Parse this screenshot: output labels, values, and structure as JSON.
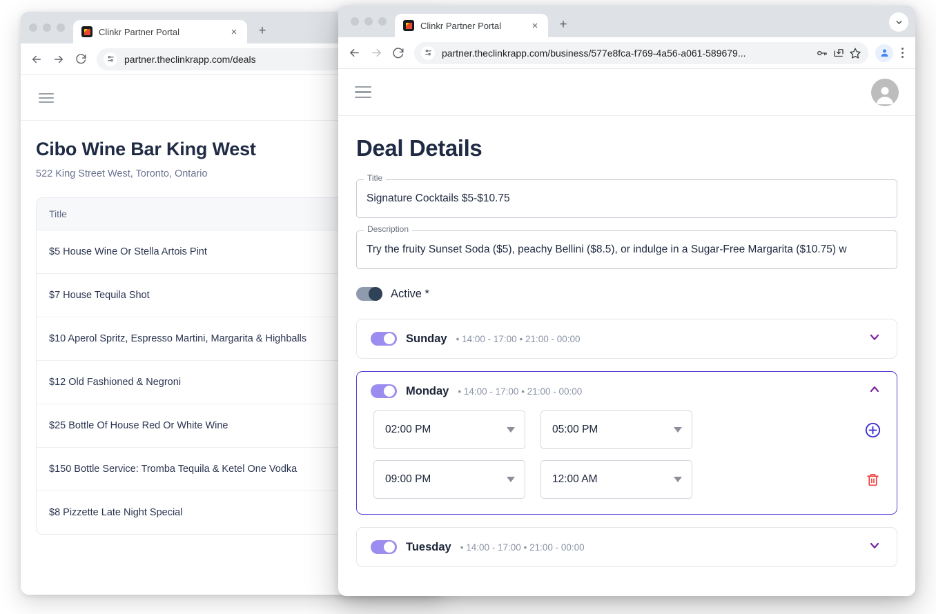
{
  "background_window": {
    "browser": {
      "tab_title": "Clinkr Partner Portal",
      "url": "partner.theclinkrapp.com/deals",
      "new_tab_label": "+",
      "close_label": "×",
      "back_icon": "back-arrow-icon",
      "forward_icon": "forward-arrow-icon",
      "reload_icon": "reload-icon"
    },
    "page": {
      "menu_icon": "hamburger-menu-icon",
      "business_name": "Cibo Wine Bar King West",
      "business_address": "522 King Street West, Toronto, Ontario",
      "table": {
        "column_header": "Title",
        "rows": [
          "$5 House Wine Or Stella Artois Pint",
          "$7 House Tequila Shot",
          "$10 Aperol Spritz, Espresso Martini, Margarita & Highballs",
          "$12 Old Fashioned & Negroni",
          "$25 Bottle Of House Red Or White Wine",
          "$150 Bottle Service: Tromba Tequila & Ketel One Vodka",
          "$8 Pizzette Late Night Special"
        ]
      }
    }
  },
  "foreground_window": {
    "browser": {
      "tab_title": "Clinkr Partner Portal",
      "url": "partner.theclinkrapp.com/business/577e8fca-f769-4a56-a061-589679...",
      "new_tab_label": "+",
      "close_label": "×",
      "toolbar_icons": [
        "back-arrow-icon",
        "forward-arrow-icon",
        "reload-icon",
        "site-settings-icon",
        "password-key-icon",
        "install-app-icon",
        "bookmark-star-icon",
        "profile-avatar-icon",
        "three-dot-menu-icon"
      ],
      "window_chevron_icon": "chevron-down-icon"
    },
    "page": {
      "menu_icon": "hamburger-menu-icon",
      "account_icon": "account-avatar-icon",
      "heading": "Deal Details",
      "fields": [
        {
          "label": "Title",
          "value": "Signature Cocktails $5-$10.75"
        },
        {
          "label": "Description",
          "value": "Try the fruity Sunset Soda ($5), peachy Bellini ($8.5), or indulge in a Sugar-Free Margarita ($10.75) w"
        }
      ],
      "active_toggle": {
        "label": "Active *",
        "state": "on"
      },
      "days": [
        {
          "name": "Sunday",
          "toggle": "on",
          "summary_separator": "•",
          "ranges": [
            "14:00 - 17:00",
            "21:00 - 00:00"
          ],
          "expanded": false,
          "chevron_icon": "chevron-down-icon"
        },
        {
          "name": "Monday",
          "toggle": "on",
          "summary_separator": "•",
          "ranges": [
            "14:00 - 17:00",
            "21:00 - 00:00"
          ],
          "expanded": true,
          "chevron_icon": "chevron-up-icon",
          "slots": [
            {
              "start": "02:00 PM",
              "end": "05:00 PM",
              "action_icon": "add-circle-icon"
            },
            {
              "start": "09:00 PM",
              "end": "12:00 AM",
              "action_icon": "delete-trash-icon"
            }
          ]
        },
        {
          "name": "Tuesday",
          "toggle": "on",
          "summary_separator": "•",
          "ranges": [
            "14:00 - 17:00",
            "21:00 - 00:00"
          ],
          "expanded": false,
          "chevron_icon": "chevron-down-icon"
        }
      ]
    }
  },
  "colors": {
    "accent_purple": "#5a3fd6",
    "toggle_purple": "#9b8cf0",
    "toggle_dark": "#2f4258",
    "chevron_purple": "#7b1fa2",
    "add_icon": "#3c2fcf",
    "delete_icon": "#f0403c",
    "heading": "#1f2a44"
  }
}
